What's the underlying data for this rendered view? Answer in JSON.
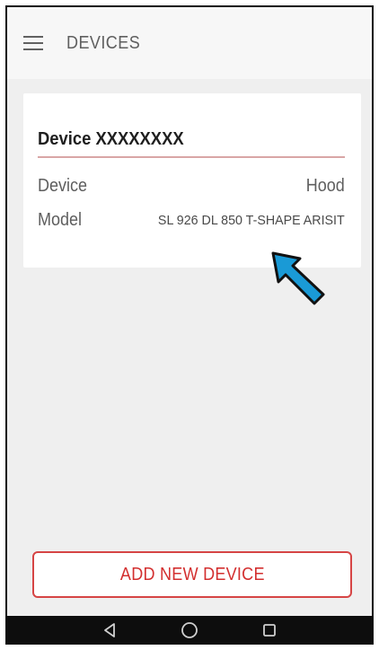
{
  "appbar": {
    "title": "DEVICES",
    "menu_icon": "hamburger-menu-icon"
  },
  "device_card": {
    "title": "Device XXXXXXXX",
    "rows": [
      {
        "label": "Device",
        "value": "Hood"
      },
      {
        "label": "Model",
        "value": "SL 926 DL 850 T-SHAPE ARISIT"
      }
    ],
    "annotation_arrow_color": "#1a9ad6"
  },
  "add_button": {
    "label": "ADD NEW DEVICE",
    "color": "#d32f2f"
  },
  "navbar": {
    "items": [
      "back-triangle-icon",
      "home-circle-icon",
      "recents-square-icon"
    ]
  }
}
